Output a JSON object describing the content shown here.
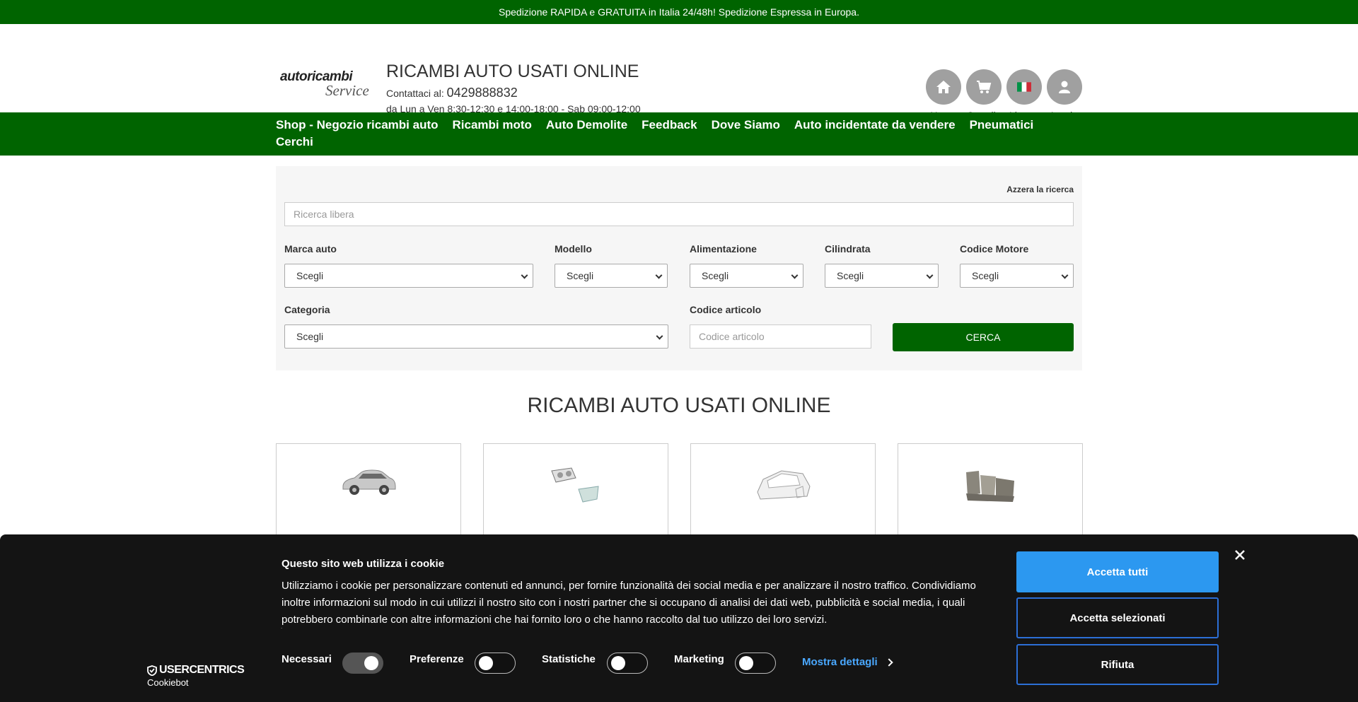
{
  "topbar": {
    "text": "Spedizione RAPIDA e GRATUITA in Italia 24/48h! Spedizione Espressa in Europa."
  },
  "header": {
    "logo_line1": "autoricambi",
    "logo_line2": "Service",
    "title": "RICAMBI AUTO USATI ONLINE",
    "contact_label": "Contattaci al: ",
    "phone": "0429888832",
    "hours": "da Lun a Ven 8:30-12:30 e 14:00-18:00 - Sab 09:00-12:00",
    "nav": {
      "home": "Home",
      "cart": "Carrello",
      "languages": "Lingue",
      "login": "Log in"
    }
  },
  "mainnav": {
    "items": [
      "Shop - Negozio ricambi auto",
      "Ricambi moto",
      "Auto Demolite",
      "Feedback",
      "Dove Siamo",
      "Auto incidentate da vendere",
      "Pneumatici",
      "Cerchi"
    ]
  },
  "search": {
    "reset": "Azzera la ricerca",
    "free_placeholder": "Ricerca libera",
    "brand_label": "Marca auto",
    "model_label": "Modello",
    "fuel_label": "Alimentazione",
    "displacement_label": "Cilindrata",
    "engine_label": "Codice Motore",
    "category_label": "Categoria",
    "code_label": "Codice articolo",
    "code_placeholder": "Codice articolo",
    "select_default": "Scegli",
    "submit": "CERCA"
  },
  "section": {
    "title": "RICAMBI AUTO USATI ONLINE"
  },
  "cookie": {
    "brand": "USERCENTRICS",
    "brand_sub": "Cookiebot",
    "title": "Questo sito web utilizza i cookie",
    "text": "Utilizziamo i cookie per personalizzare contenuti ed annunci, per fornire funzionalità dei social media e per analizzare il nostro traffico. Condividiamo inoltre informazioni sul modo in cui utilizzi il nostro sito con i nostri partner che si occupano di analisi dei dati web, pubblicità e social media, i quali potrebbero combinarle con altre informazioni che hai fornito loro o che hanno raccolto dal tuo utilizzo dei loro servizi.",
    "necessary": "Necessari",
    "preferences": "Preferenze",
    "statistics": "Statistiche",
    "marketing": "Marketing",
    "details": "Mostra dettagli",
    "accept_all": "Accetta tutti",
    "accept_selected": "Accetta selezionati",
    "reject": "Rifiuta",
    "toggles": {
      "necessary": true,
      "preferences": false,
      "statistics": false,
      "marketing": false
    }
  },
  "colors": {
    "brand_green": "#006400",
    "cookie_blue": "#2c98f0",
    "cookie_bg": "#141414"
  }
}
